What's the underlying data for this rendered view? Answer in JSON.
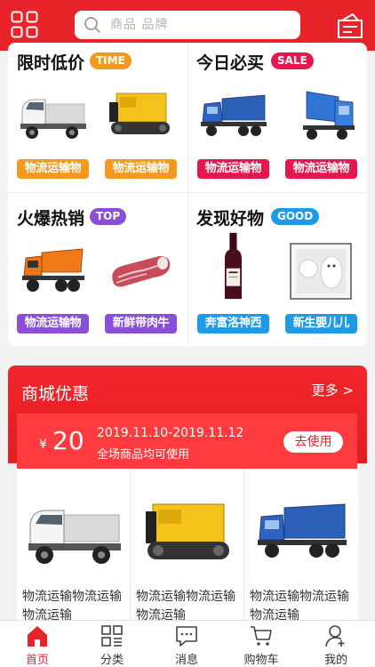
{
  "header": {
    "search_placeholder": "商品 品牌",
    "menu_icon": "grid-menu-icon",
    "message_icon": "message-box-icon",
    "background": "#e8232a"
  },
  "promo": {
    "sections": [
      {
        "title": "限时低价",
        "badge": "TIME",
        "badge_color": "#f39a1e",
        "items": [
          {
            "label": "物流运输物",
            "label_color": "#f39a1e",
            "image": "small-truck"
          },
          {
            "label": "物流运输物",
            "label_color": "#f39a1e",
            "image": "crawler-carrier"
          }
        ]
      },
      {
        "title": "今日必买",
        "badge": "SALE",
        "badge_color": "#e5184d",
        "items": [
          {
            "label": "物流运输物",
            "label_color": "#e5184d",
            "image": "blue-dump-truck"
          },
          {
            "label": "物流运输物",
            "label_color": "#e5184d",
            "image": "blue-dump-truck"
          }
        ]
      },
      {
        "title": "火爆热销",
        "badge": "TOP",
        "badge_color": "#8a4fd6",
        "items": [
          {
            "label": "物流运输物",
            "label_color": "#8a4fd6",
            "image": "orange-dump-truck"
          },
          {
            "label": "新鲜带肉牛",
            "label_color": "#8a4fd6",
            "image": "beef-meat"
          }
        ]
      },
      {
        "title": "发现好物",
        "badge": "GOOD",
        "badge_color": "#1e9be8",
        "items": [
          {
            "label": "奔富洛神西",
            "label_color": "#1e9be8",
            "image": "wine-bottle"
          },
          {
            "label": "新生婴儿儿",
            "label_color": "#1e9be8",
            "image": "baby-toy-box"
          }
        ]
      }
    ]
  },
  "mall": {
    "title": "商城优惠",
    "more": "更多 >",
    "coupon": {
      "currency": "¥",
      "amount": "20",
      "date_range": "2019.11.10-2019.11.12",
      "description": "全场商品均可使用",
      "button": "去使用"
    },
    "products": [
      {
        "name": "物流运输物流运输物流运输",
        "image": "small-truck"
      },
      {
        "name": "物流运输物流运输物流运输",
        "image": "crawler-carrier"
      },
      {
        "name": "物流运输物流运输物流运输",
        "image": "blue-dump-truck"
      }
    ]
  },
  "tabbar": {
    "items": [
      {
        "label": "首页",
        "icon": "home-icon",
        "active": true
      },
      {
        "label": "分类",
        "icon": "category-icon",
        "active": false
      },
      {
        "label": "消息",
        "icon": "message-icon",
        "active": false
      },
      {
        "label": "购物车",
        "icon": "cart-icon",
        "active": false
      },
      {
        "label": "我的",
        "icon": "user-icon",
        "active": false
      }
    ],
    "active_color": "#e8232a"
  }
}
